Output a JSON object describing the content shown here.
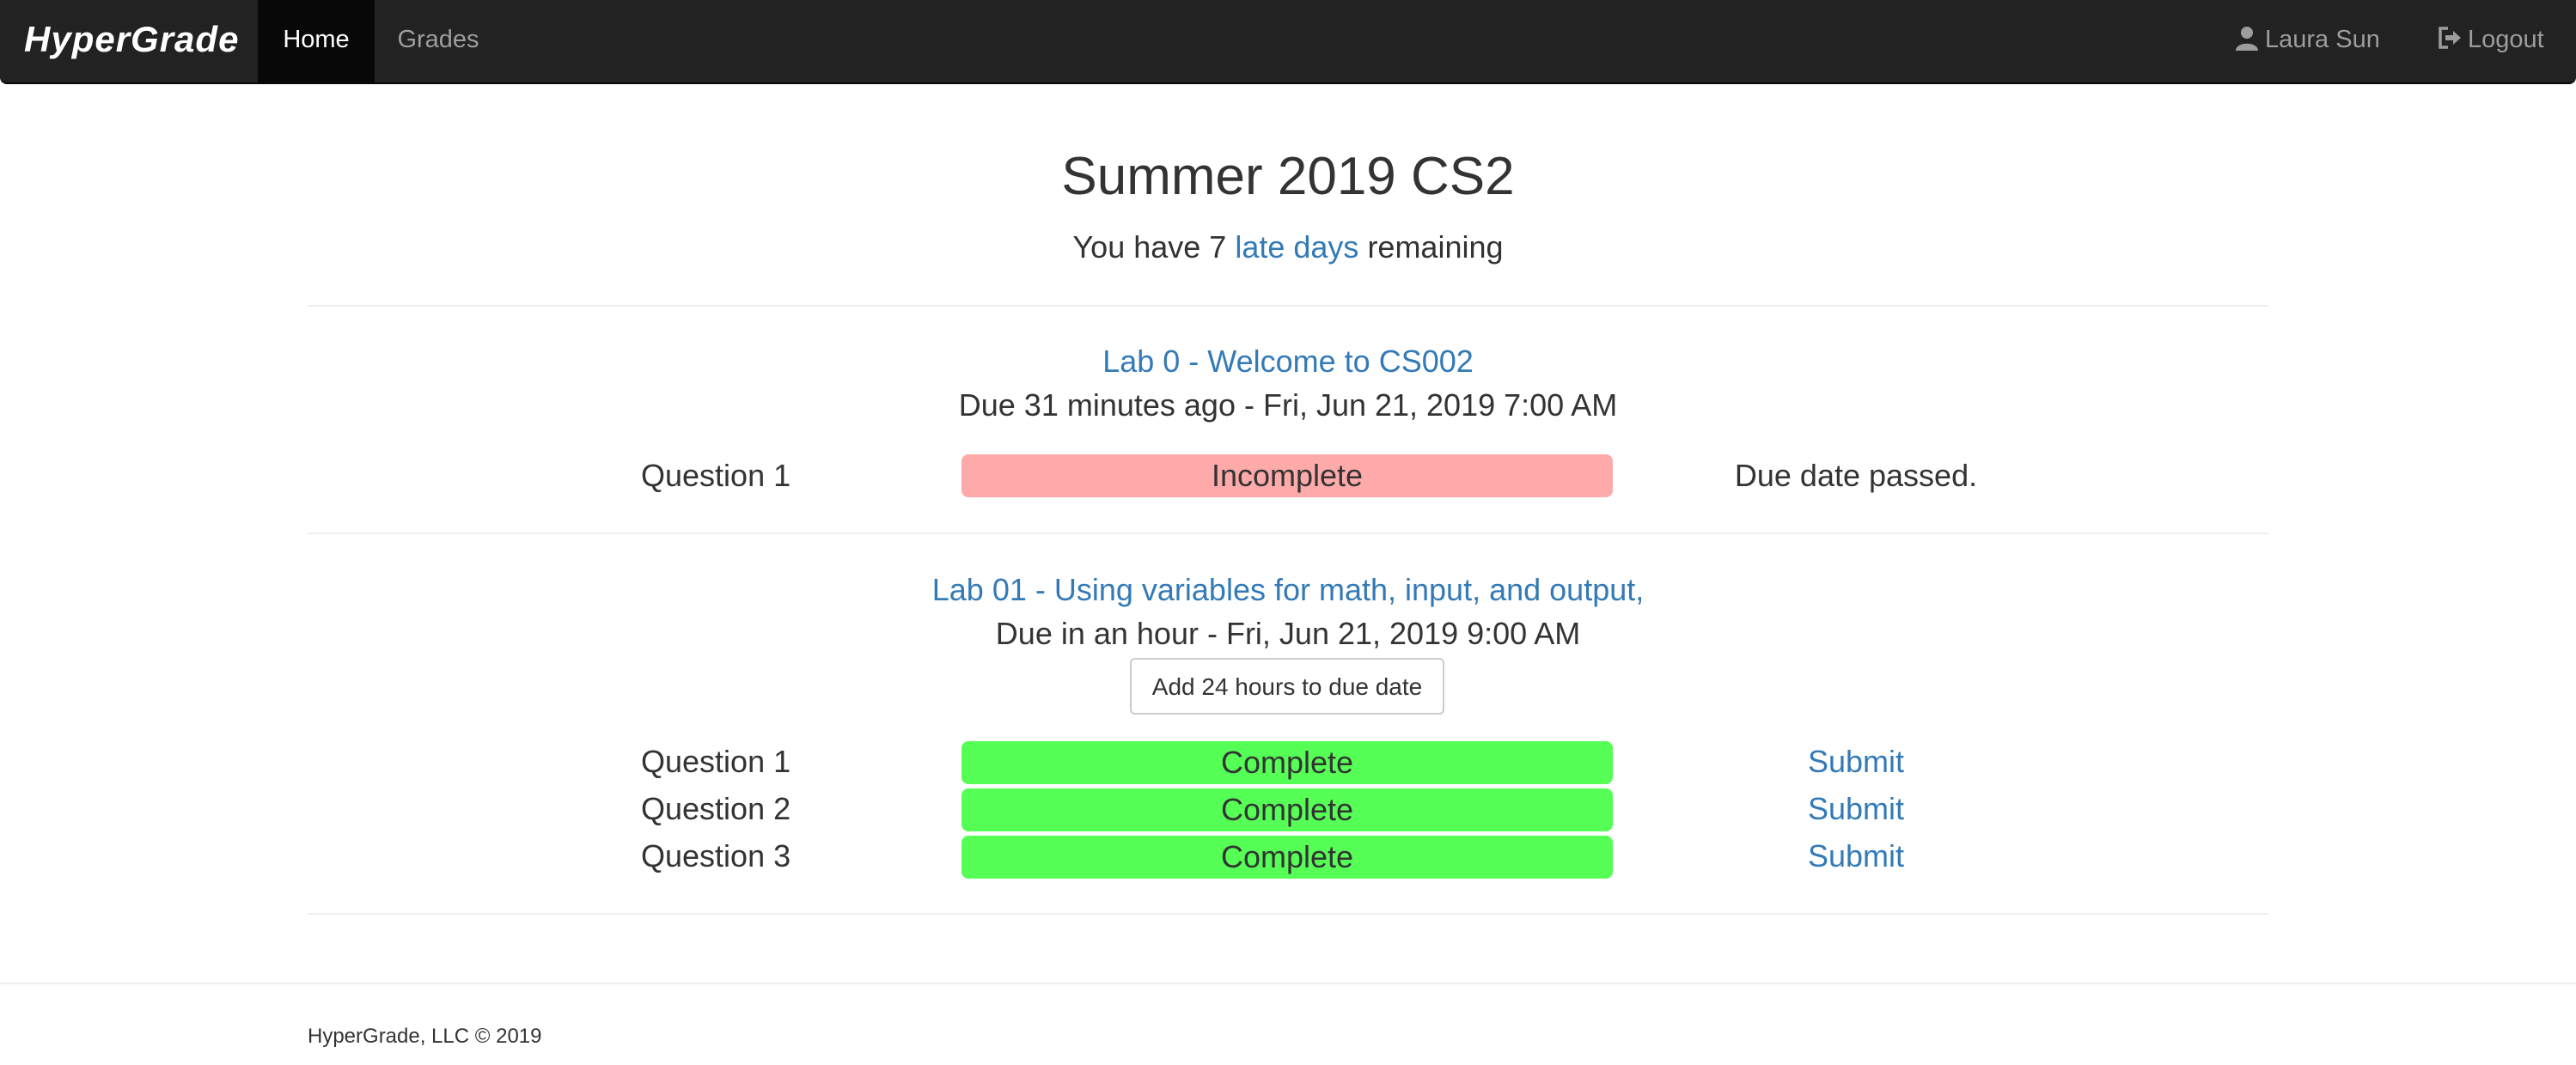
{
  "navbar": {
    "brand": "HyperGrade",
    "tabs": [
      {
        "label": "Home",
        "active": true
      },
      {
        "label": "Grades",
        "active": false
      }
    ],
    "user": {
      "name": "Laura Sun",
      "icon": "user-icon"
    },
    "logout": {
      "label": "Logout",
      "icon": "logout-icon"
    }
  },
  "course": {
    "title": "Summer 2019 CS2",
    "late_days": {
      "prefix": "You have 7",
      "link": "late days",
      "suffix": "remaining"
    }
  },
  "assignments": [
    {
      "title": "Lab 0 - Welcome to CS002",
      "due": "Due 31 minutes ago - Fri, Jun 21, 2019 7:00 AM",
      "questions": [
        {
          "label": "Question 1",
          "status": "Incomplete",
          "action": "Due date passed."
        }
      ]
    },
    {
      "title": "Lab 01 - Using variables for math, input, and output,",
      "due": "Due in an hour - Fri, Jun 21, 2019 9:00 AM",
      "extend_button": "Add 24 hours to due date",
      "questions": [
        {
          "label": "Question 1",
          "status": "Complete",
          "action": "Submit"
        },
        {
          "label": "Question 2",
          "status": "Complete",
          "action": "Submit"
        },
        {
          "label": "Question 3",
          "status": "Complete",
          "action": "Submit"
        }
      ]
    }
  ],
  "footer": {
    "text": "HyperGrade, LLC © 2019"
  },
  "colors": {
    "navbar_bg": "#222222",
    "active_tab_bg": "#080808",
    "link": "#337ab7",
    "incomplete": "#ffaaaa",
    "complete": "#55ff55"
  }
}
